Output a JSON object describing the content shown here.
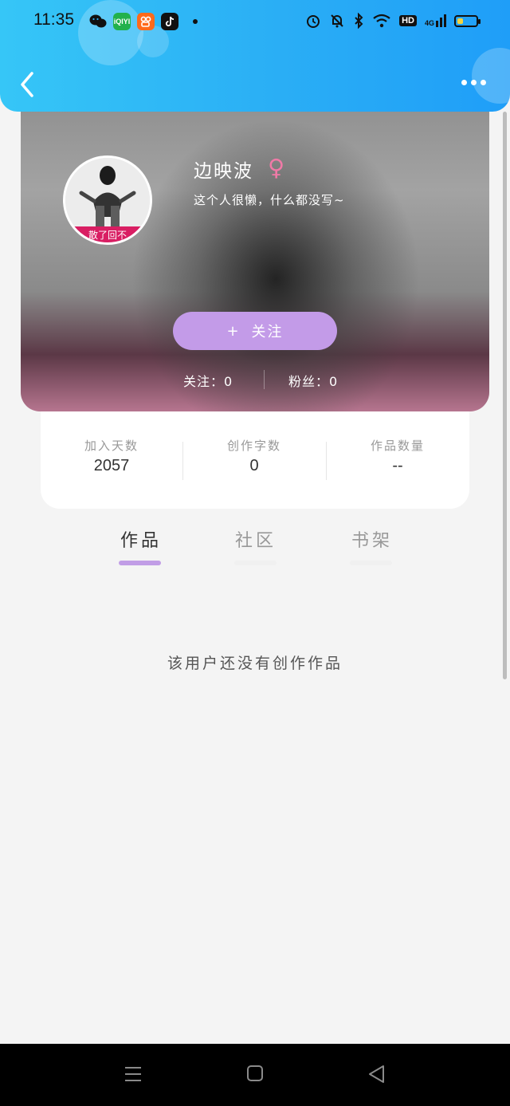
{
  "status_bar": {
    "time": "11:35",
    "apps": [
      {
        "icon": "wechat-icon",
        "color": "#111111"
      },
      {
        "icon": "iqiyi-icon",
        "color": "#22b14c",
        "text": "iQIYI"
      },
      {
        "icon": "kuaishou-icon",
        "color": "#ff6a1a"
      },
      {
        "icon": "tiktok-icon",
        "color": "#111111"
      }
    ],
    "hd_label": "HD",
    "network": "4G",
    "battery_level": 0.3
  },
  "profile": {
    "name": "边映波",
    "gender_symbol": "♀",
    "bio": "这个人很懒，什么都没写~",
    "avatar_caption": "散了回不",
    "follow_plus": "+",
    "follow_label": "关注",
    "following": "关注：0",
    "followers": "粉丝：0"
  },
  "stats": [
    {
      "label": "加入天数",
      "value": "2057"
    },
    {
      "label": "创作字数",
      "value": "0"
    },
    {
      "label": "作品数量",
      "value": "--"
    }
  ],
  "tabs": [
    {
      "label": "作品",
      "active": true
    },
    {
      "label": "社区",
      "active": false
    },
    {
      "label": "书架",
      "active": false
    }
  ],
  "empty_message": "该用户还没有创作作品",
  "colors": {
    "header": "#2aaef5",
    "accent": "#c39be8",
    "tab_indicator": "#c19de6",
    "gender": "#f07aa7"
  }
}
